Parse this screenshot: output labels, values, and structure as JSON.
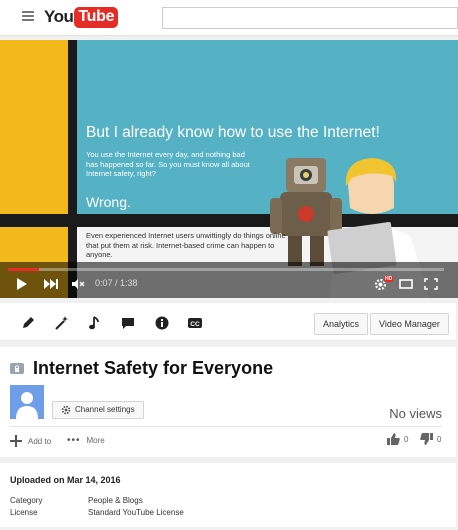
{
  "masthead": {
    "logo_you": "You",
    "logo_tube": "Tube",
    "search_placeholder": ""
  },
  "video": {
    "slide_heading": "But I already know how to use the Internet!",
    "slide_body": "You use the Internet every day, and nothing bad has happened so far. So you must know all about Internet safety, right?",
    "slide_answer": "Wrong.",
    "slide_footer": "Even experienced Internet users unwittingly do things online that put them at risk. Internet-based crime can happen to anyone.",
    "time_display": "0:07 / 1:38",
    "progress": 0.072,
    "hd_badge": "HD"
  },
  "creator_bar": {
    "tools": [
      "pencil-icon",
      "magic-wand-icon",
      "music-note-icon",
      "comment-icon",
      "info-icon",
      "cc-icon"
    ],
    "analytics_label": "Analytics",
    "video_manager_label": "Video Manager"
  },
  "info": {
    "title": "Internet Safety for Everyone",
    "channel_settings_label": "Channel settings",
    "views": "No views",
    "add_to_label": "Add to",
    "more_label": "More",
    "like_count": "0",
    "dislike_count": "0"
  },
  "description": {
    "uploaded": "Uploaded on Mar 14, 2016",
    "category_label": "Category",
    "category_value": "People & Blogs",
    "license_label": "License",
    "license_value": "Standard YouTube License"
  },
  "colors": {
    "accent_red": "#e52d27",
    "slide_teal": "#55b1c4",
    "slide_yellow": "#f2b81c"
  }
}
